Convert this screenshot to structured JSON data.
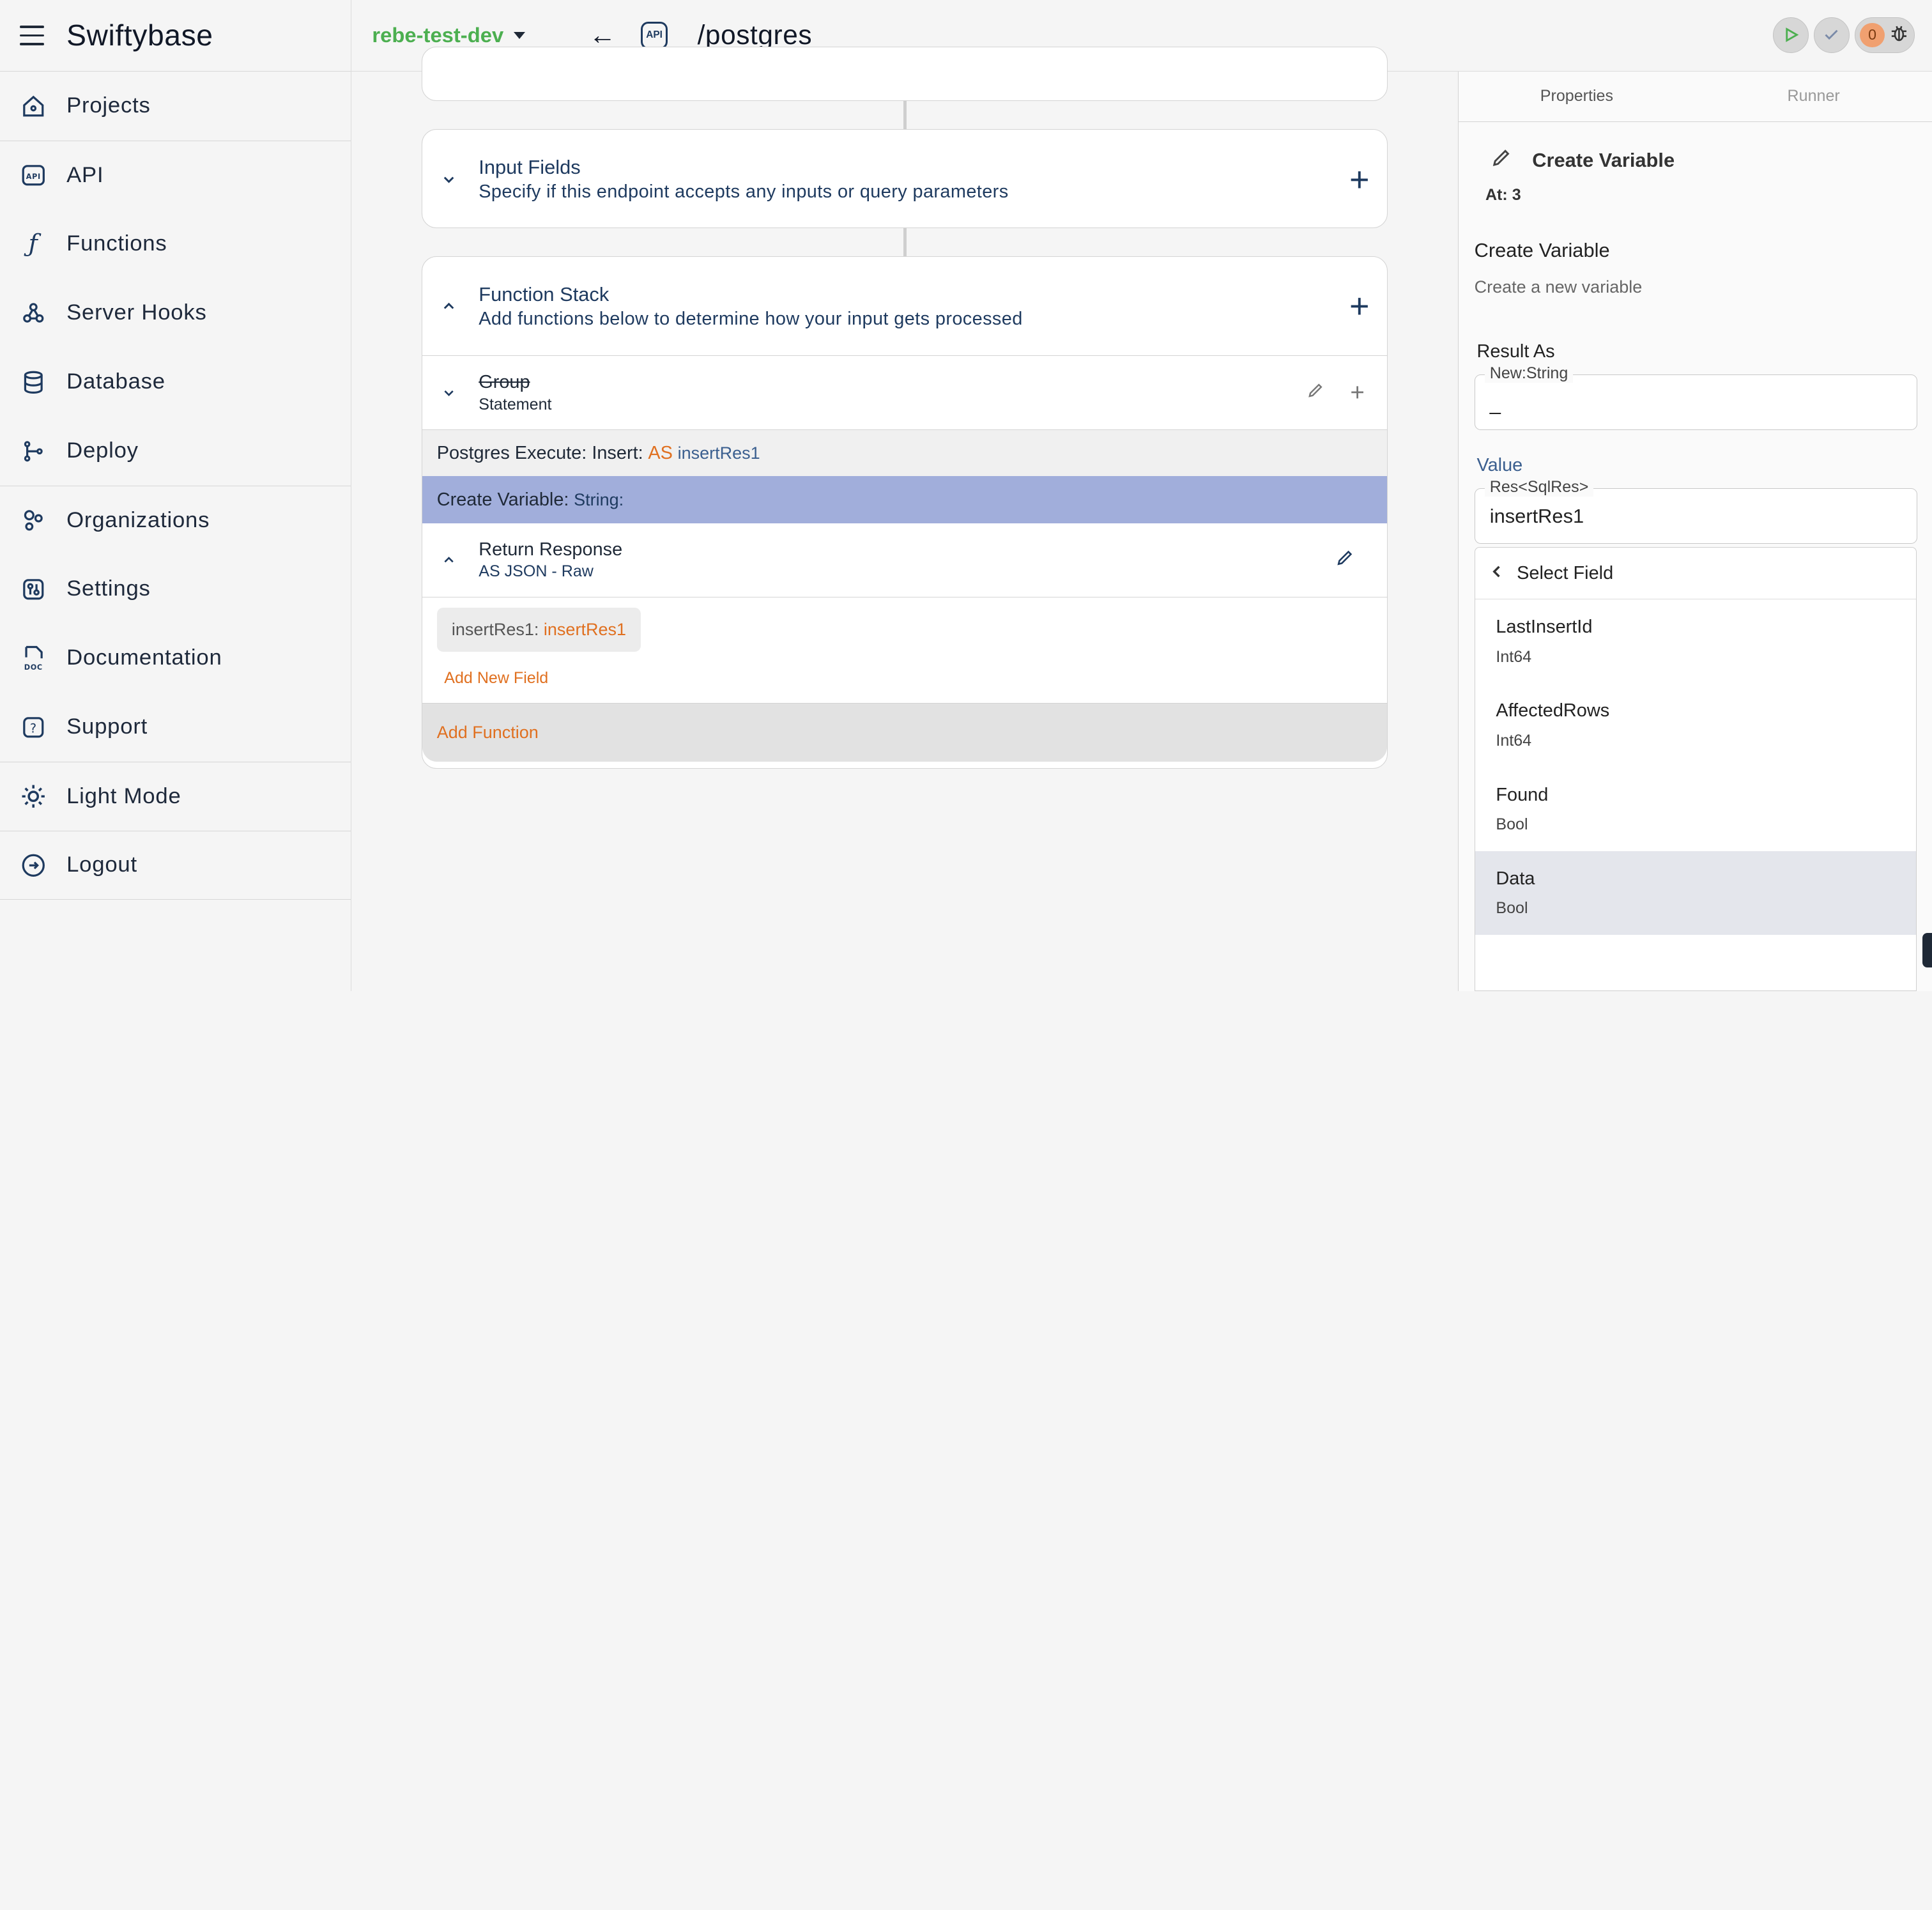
{
  "app": {
    "title": "Swiftybase"
  },
  "sidebar": {
    "items": [
      {
        "label": "Projects",
        "icon": "home-icon"
      },
      {
        "label": "API",
        "icon": "api-icon"
      },
      {
        "label": "Functions",
        "icon": "function-icon"
      },
      {
        "label": "Server Hooks",
        "icon": "webhook-icon"
      },
      {
        "label": "Database",
        "icon": "database-icon"
      },
      {
        "label": "Deploy",
        "icon": "git-branch-icon"
      },
      {
        "label": "Organizations",
        "icon": "organizations-icon"
      },
      {
        "label": "Settings",
        "icon": "settings-icon"
      },
      {
        "label": "Documentation",
        "icon": "doc-icon"
      },
      {
        "label": "Support",
        "icon": "help-icon"
      },
      {
        "label": "Light Mode",
        "icon": "sun-icon"
      },
      {
        "label": "Logout",
        "icon": "logout-icon"
      }
    ]
  },
  "topbar": {
    "environment": "rebe-test-dev",
    "api_badge": "API",
    "route": "/postgres",
    "error_count": "0"
  },
  "main": {
    "input_fields": {
      "title": "Input Fields",
      "subtitle": "Specify if this endpoint accepts any inputs or query parameters"
    },
    "function_stack": {
      "title": "Function Stack",
      "subtitle": "Add functions below to determine how your input gets processed"
    },
    "group": {
      "title": "Group",
      "subtitle": "Statement"
    },
    "postgres": {
      "prefix": "Postgres Execute: Insert:",
      "as": "AS",
      "var": "insertRes1"
    },
    "create_var": {
      "prefix": "Create Variable:",
      "type": "String:"
    },
    "return_response": {
      "title": "Return Response",
      "subtitle": "AS JSON - Raw"
    },
    "field_chip": {
      "key": "insertRes1:",
      "value": "insertRes1"
    },
    "add_new_field": "Add New Field",
    "add_function": "Add Function"
  },
  "panel": {
    "tabs": [
      "Properties",
      "Runner"
    ],
    "heading": "Create Variable",
    "at": "At: 3",
    "title": "Create Variable",
    "desc": "Create a new variable",
    "result_as_label": "Result As",
    "result_legend": "New:String",
    "result_value": "_",
    "value_label": "Value",
    "value_legend": "Res<SqlRes>",
    "value_value": "insertRes1",
    "select_field": "Select Field",
    "options": [
      {
        "name": "LastInsertId",
        "type": "Int64"
      },
      {
        "name": "AffectedRows",
        "type": "Int64"
      },
      {
        "name": "Found",
        "type": "Bool"
      },
      {
        "name": "Data",
        "type": "Bool"
      }
    ]
  }
}
